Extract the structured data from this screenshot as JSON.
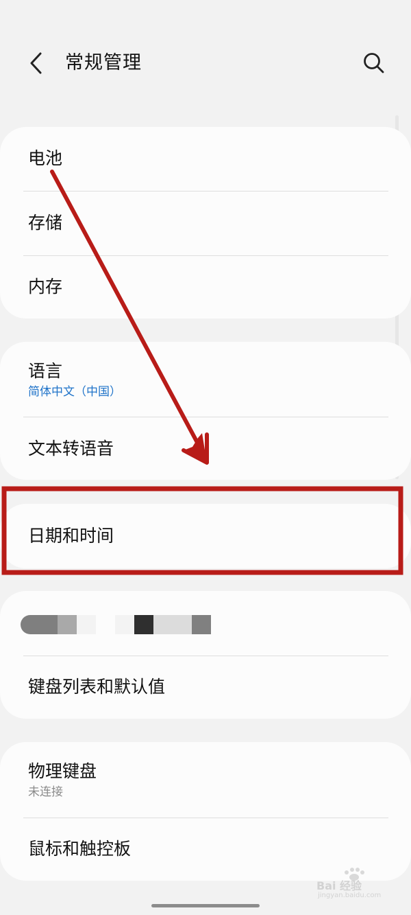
{
  "header": {
    "title": "常规管理",
    "back_icon": "chevron-left-icon",
    "search_icon": "search-icon"
  },
  "groups": [
    {
      "items": [
        {
          "label": "电池"
        },
        {
          "label": "存储"
        },
        {
          "label": "内存"
        }
      ]
    },
    {
      "items": [
        {
          "label": "语言",
          "subtitle": "简体中文（中国）"
        },
        {
          "label": "文本转语音"
        }
      ]
    },
    {
      "items": [
        {
          "label": "日期和时间"
        }
      ]
    },
    {
      "items": [
        {
          "label": "键盘列表和默认值"
        }
      ]
    },
    {
      "items": [
        {
          "label": "物理键盘",
          "subtitle": "未连接"
        },
        {
          "label": "鼠标和触控板"
        }
      ]
    }
  ],
  "annotation": {
    "highlight_color": "#b81c18",
    "arrow_color": "#b81c18"
  },
  "colors": {
    "background": "#f2f2f2",
    "card": "#fcfcfc",
    "subtitle_accent": "#1f73c9",
    "subtitle_muted": "#8a8a8a"
  },
  "watermark": {
    "text": "Bai 经验",
    "sub": "jingyan.baidu.com"
  }
}
